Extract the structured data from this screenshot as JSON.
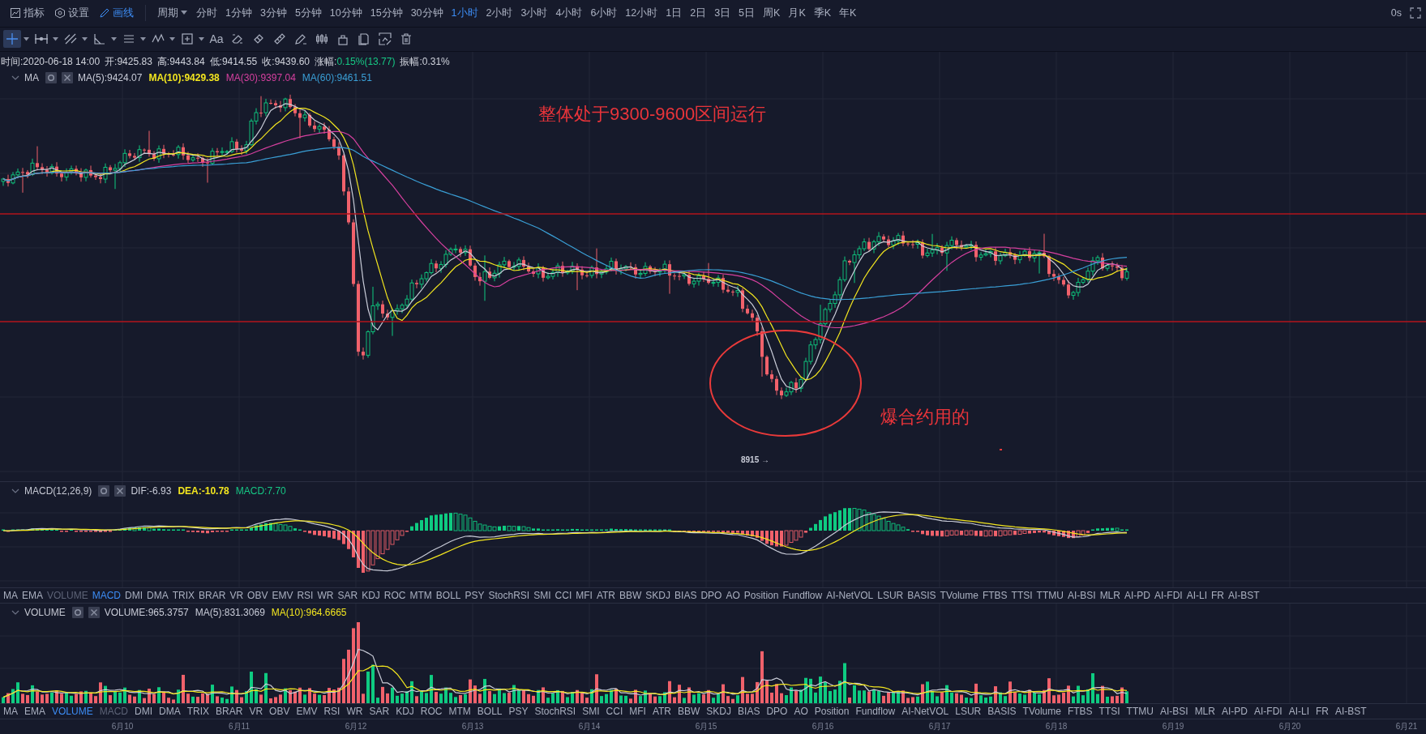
{
  "top_bar": {
    "menu": [
      {
        "label": "指标",
        "selected": false
      },
      {
        "label": "设置",
        "selected": false
      },
      {
        "label": "画线",
        "selected": true
      }
    ],
    "period_label": "周期",
    "periods": [
      {
        "label": "分时",
        "selected": false
      },
      {
        "label": "1分钟",
        "selected": false
      },
      {
        "label": "3分钟",
        "selected": false
      },
      {
        "label": "5分钟",
        "selected": false
      },
      {
        "label": "10分钟",
        "selected": false
      },
      {
        "label": "15分钟",
        "selected": false
      },
      {
        "label": "30分钟",
        "selected": false
      },
      {
        "label": "1小时",
        "selected": true
      },
      {
        "label": "2小时",
        "selected": false
      },
      {
        "label": "3小时",
        "selected": false
      },
      {
        "label": "4小时",
        "selected": false
      },
      {
        "label": "6小时",
        "selected": false
      },
      {
        "label": "12小时",
        "selected": false
      },
      {
        "label": "1日",
        "selected": false
      },
      {
        "label": "2日",
        "selected": false
      },
      {
        "label": "3日",
        "selected": false
      },
      {
        "label": "5日",
        "selected": false
      },
      {
        "label": "周K",
        "selected": false
      },
      {
        "label": "月K",
        "selected": false
      },
      {
        "label": "季K",
        "selected": false
      },
      {
        "label": "年K",
        "selected": false
      }
    ],
    "timer": "0s"
  },
  "drawing_tools": [
    {
      "kind": "crosshair",
      "selected": true,
      "caret": true
    },
    {
      "kind": "horizontal-line",
      "selected": false,
      "caret": true
    },
    {
      "kind": "trend-line",
      "selected": false,
      "caret": true
    },
    {
      "kind": "angle",
      "selected": false,
      "caret": true
    },
    {
      "kind": "parallel-lines",
      "selected": false,
      "caret": true
    },
    {
      "kind": "wave",
      "selected": false,
      "caret": true
    },
    {
      "kind": "box",
      "selected": false,
      "caret": true
    },
    {
      "kind": "text",
      "label": "Aa",
      "selected": false,
      "caret": false
    },
    {
      "kind": "eraser",
      "selected": false,
      "caret": false
    },
    {
      "kind": "magnet",
      "selected": false,
      "caret": false
    },
    {
      "kind": "ruler",
      "selected": false,
      "caret": false
    },
    {
      "kind": "pen",
      "selected": false,
      "caret": false
    },
    {
      "kind": "candles",
      "selected": false,
      "caret": false
    },
    {
      "kind": "lock",
      "selected": false,
      "caret": false
    },
    {
      "kind": "copy",
      "selected": false,
      "caret": false
    },
    {
      "kind": "screenshot",
      "selected": false,
      "caret": false
    },
    {
      "kind": "trash",
      "selected": false,
      "caret": false
    }
  ],
  "main_pane": {
    "ohlc": [
      {
        "label": "时间:",
        "value": "2020-06-18 14:00",
        "rising": false
      },
      {
        "label": "开:",
        "value": "9425.83",
        "rising": false
      },
      {
        "label": "高:",
        "value": "9443.84",
        "rising": false
      },
      {
        "label": "低:",
        "value": "9414.55",
        "rising": false
      },
      {
        "label": "收:",
        "value": "9439.60",
        "rising": false
      },
      {
        "label": "涨幅:",
        "value": "0.15%(13.77)",
        "rising": true
      },
      {
        "label": "振幅:",
        "value": "0.31%",
        "rising": false
      }
    ],
    "legend_title": "MA",
    "values": [
      {
        "text": "MA(5):9424.07",
        "color": "#c9ccd8"
      },
      {
        "text": "MA(10):9429.38",
        "color": "#f2e51f"
      },
      {
        "text": "MA(30):9397.04",
        "color": "#d6409f"
      },
      {
        "text": "MA(60):9461.51",
        "color": "#3a9fd6"
      }
    ],
    "annotations": [
      {
        "kind": "note",
        "text": "整体处于9300-9600区间运行"
      },
      {
        "kind": "note",
        "text": "爆合约用的"
      },
      {
        "kind": "price-label",
        "text": "8915 →"
      }
    ]
  },
  "macd_pane": {
    "legend_title": "MACD(12,26,9)",
    "values": [
      {
        "text": "DIF:-6.93",
        "color": "#c9ccd8"
      },
      {
        "text": "DEA:-10.78",
        "color": "#f2e51f"
      },
      {
        "text": "MACD:7.70",
        "color": "#16c784"
      }
    ],
    "indicator_tabs": [
      {
        "label": "MA",
        "selected": false,
        "dimmed": false
      },
      {
        "label": "EMA",
        "selected": false,
        "dimmed": false
      },
      {
        "label": "VOLUME",
        "selected": false,
        "dimmed": true
      },
      {
        "label": "MACD",
        "selected": true,
        "dimmed": false
      },
      {
        "label": "DMI",
        "selected": false,
        "dimmed": false
      },
      {
        "label": "DMA",
        "selected": false,
        "dimmed": false
      },
      {
        "label": "TRIX",
        "selected": false,
        "dimmed": false
      },
      {
        "label": "BRAR",
        "selected": false,
        "dimmed": false
      },
      {
        "label": "VR",
        "selected": false,
        "dimmed": false
      },
      {
        "label": "OBV",
        "selected": false,
        "dimmed": false
      },
      {
        "label": "EMV",
        "selected": false,
        "dimmed": false
      },
      {
        "label": "RSI",
        "selected": false,
        "dimmed": false
      },
      {
        "label": "WR",
        "selected": false,
        "dimmed": false
      },
      {
        "label": "SAR",
        "selected": false,
        "dimmed": false
      },
      {
        "label": "KDJ",
        "selected": false,
        "dimmed": false
      },
      {
        "label": "ROC",
        "selected": false,
        "dimmed": false
      },
      {
        "label": "MTM",
        "selected": false,
        "dimmed": false
      },
      {
        "label": "BOLL",
        "selected": false,
        "dimmed": false
      },
      {
        "label": "PSY",
        "selected": false,
        "dimmed": false
      },
      {
        "label": "StochRSI",
        "selected": false,
        "dimmed": false
      },
      {
        "label": "SMI",
        "selected": false,
        "dimmed": false
      },
      {
        "label": "CCI",
        "selected": false,
        "dimmed": false
      },
      {
        "label": "MFI",
        "selected": false,
        "dimmed": false
      },
      {
        "label": "ATR",
        "selected": false,
        "dimmed": false
      },
      {
        "label": "BBW",
        "selected": false,
        "dimmed": false
      },
      {
        "label": "SKDJ",
        "selected": false,
        "dimmed": false
      },
      {
        "label": "BIAS",
        "selected": false,
        "dimmed": false
      },
      {
        "label": "DPO",
        "selected": false,
        "dimmed": false
      },
      {
        "label": "AO",
        "selected": false,
        "dimmed": false
      },
      {
        "label": "Position",
        "selected": false,
        "dimmed": false
      },
      {
        "label": "Fundflow",
        "selected": false,
        "dimmed": false
      },
      {
        "label": "AI-NetVOL",
        "selected": false,
        "dimmed": false
      },
      {
        "label": "LSUR",
        "selected": false,
        "dimmed": false
      },
      {
        "label": "BASIS",
        "selected": false,
        "dimmed": false
      },
      {
        "label": "TVolume",
        "selected": false,
        "dimmed": false
      },
      {
        "label": "FTBS",
        "selected": false,
        "dimmed": false
      },
      {
        "label": "TTSI",
        "selected": false,
        "dimmed": false
      },
      {
        "label": "TTMU",
        "selected": false,
        "dimmed": false
      },
      {
        "label": "AI-BSI",
        "selected": false,
        "dimmed": false
      },
      {
        "label": "MLR",
        "selected": false,
        "dimmed": false
      },
      {
        "label": "AI-PD",
        "selected": false,
        "dimmed": false
      },
      {
        "label": "AI-FDI",
        "selected": false,
        "dimmed": false
      },
      {
        "label": "AI-LI",
        "selected": false,
        "dimmed": false
      },
      {
        "label": "FR",
        "selected": false,
        "dimmed": false
      },
      {
        "label": "AI-BST",
        "selected": false,
        "dimmed": false
      }
    ]
  },
  "volume_pane": {
    "legend_title": "VOLUME",
    "values": [
      {
        "text": "VOLUME:965.3757",
        "color": "#c9ccd8"
      },
      {
        "text": "MA(5):831.3069",
        "color": "#c9ccd8"
      },
      {
        "text": "MA(10):964.6665",
        "color": "#f2e51f"
      }
    ],
    "indicator_tabs": [
      {
        "label": "MA",
        "selected": false,
        "dimmed": false
      },
      {
        "label": "EMA",
        "selected": false,
        "dimmed": false
      },
      {
        "label": "VOLUME",
        "selected": true,
        "dimmed": false
      },
      {
        "label": "MACD",
        "selected": false,
        "dimmed": true
      },
      {
        "label": "DMI",
        "selected": false,
        "dimmed": false
      },
      {
        "label": "DMA",
        "selected": false,
        "dimmed": false
      },
      {
        "label": "TRIX",
        "selected": false,
        "dimmed": false
      },
      {
        "label": "BRAR",
        "selected": false,
        "dimmed": false
      },
      {
        "label": "VR",
        "selected": false,
        "dimmed": false
      },
      {
        "label": "OBV",
        "selected": false,
        "dimmed": false
      },
      {
        "label": "EMV",
        "selected": false,
        "dimmed": false
      },
      {
        "label": "RSI",
        "selected": false,
        "dimmed": false
      },
      {
        "label": "WR",
        "selected": false,
        "dimmed": false
      },
      {
        "label": "SAR",
        "selected": false,
        "dimmed": false
      },
      {
        "label": "KDJ",
        "selected": false,
        "dimmed": false
      },
      {
        "label": "ROC",
        "selected": false,
        "dimmed": false
      },
      {
        "label": "MTM",
        "selected": false,
        "dimmed": false
      },
      {
        "label": "BOLL",
        "selected": false,
        "dimmed": false
      },
      {
        "label": "PSY",
        "selected": false,
        "dimmed": false
      },
      {
        "label": "StochRSI",
        "selected": false,
        "dimmed": false
      },
      {
        "label": "SMI",
        "selected": false,
        "dimmed": false
      },
      {
        "label": "CCI",
        "selected": false,
        "dimmed": false
      },
      {
        "label": "MFI",
        "selected": false,
        "dimmed": false
      },
      {
        "label": "ATR",
        "selected": false,
        "dimmed": false
      },
      {
        "label": "BBW",
        "selected": false,
        "dimmed": false
      },
      {
        "label": "SKDJ",
        "selected": false,
        "dimmed": false
      },
      {
        "label": "BIAS",
        "selected": false,
        "dimmed": false
      },
      {
        "label": "DPO",
        "selected": false,
        "dimmed": false
      },
      {
        "label": "AO",
        "selected": false,
        "dimmed": false
      },
      {
        "label": "Position",
        "selected": false,
        "dimmed": false
      },
      {
        "label": "Fundflow",
        "selected": false,
        "dimmed": false
      },
      {
        "label": "AI-NetVOL",
        "selected": false,
        "dimmed": false
      },
      {
        "label": "LSUR",
        "selected": false,
        "dimmed": false
      },
      {
        "label": "BASIS",
        "selected": false,
        "dimmed": false
      },
      {
        "label": "TVolume",
        "selected": false,
        "dimmed": false
      },
      {
        "label": "FTBS",
        "selected": false,
        "dimmed": false
      },
      {
        "label": "TTSI",
        "selected": false,
        "dimmed": false
      },
      {
        "label": "TTMU",
        "selected": false,
        "dimmed": false
      },
      {
        "label": "AI-BSI",
        "selected": false,
        "dimmed": false
      },
      {
        "label": "MLR",
        "selected": false,
        "dimmed": false
      },
      {
        "label": "AI-PD",
        "selected": false,
        "dimmed": false
      },
      {
        "label": "AI-FDI",
        "selected": false,
        "dimmed": false
      },
      {
        "label": "AI-LI",
        "selected": false,
        "dimmed": false
      },
      {
        "label": "FR",
        "selected": false,
        "dimmed": false
      },
      {
        "label": "AI-BST",
        "selected": false,
        "dimmed": false
      }
    ]
  },
  "date_axis": [
    "6月10",
    "6月11",
    "6月12",
    "6月13",
    "6月14",
    "6月15",
    "6月16",
    "6月17",
    "6月18",
    "6月19",
    "6月20",
    "6月21"
  ]
}
